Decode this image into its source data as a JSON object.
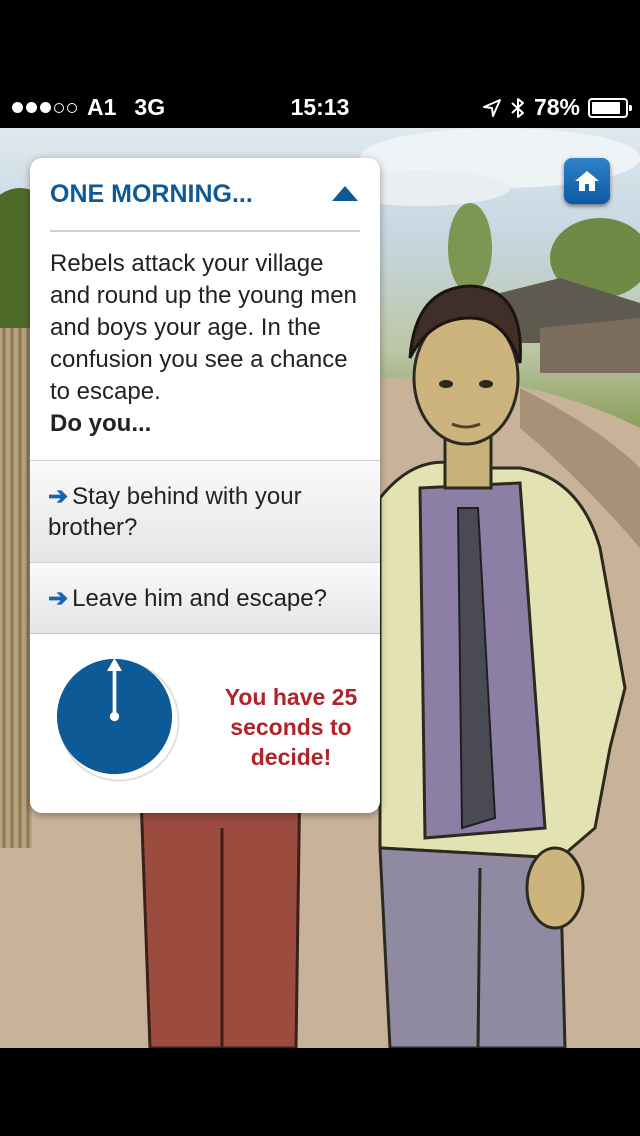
{
  "status_bar": {
    "carrier": "A1",
    "network": "3G",
    "time": "15:13",
    "battery": "78%",
    "battery_level": 0.78,
    "signal_bars_filled": 3,
    "signal_bars_total": 5
  },
  "card": {
    "title": "ONE MORNING...",
    "story": "Rebels attack your village and round up the young men and boys your age. In the confusion you see a chance to escape.",
    "prompt": "Do you...",
    "choices": [
      {
        "arrow": "➔",
        "label": "Stay behind with your brother?"
      },
      {
        "arrow": "➔",
        "label": "Leave him and escape?"
      }
    ],
    "timer_text": "You have 25 seconds to decide!"
  },
  "colors": {
    "accent": "#0d5a96",
    "warning": "#b3222a"
  },
  "icons": [
    "home-icon",
    "location-arrow-icon",
    "bluetooth-icon",
    "battery-icon",
    "collapse-arrow-icon",
    "choice-arrow-icon",
    "clock-icon"
  ]
}
